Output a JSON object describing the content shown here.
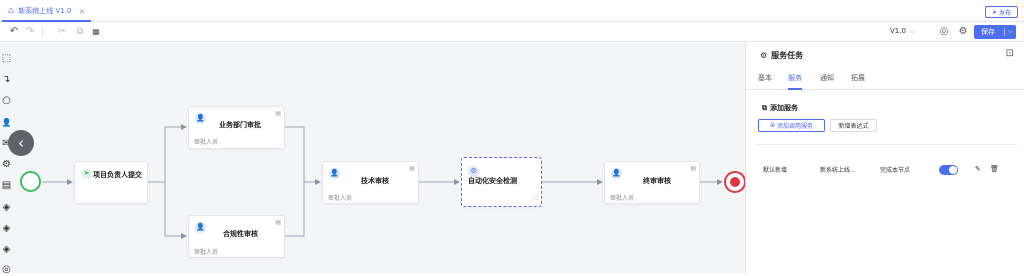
{
  "tab": {
    "icon": "flow-icon",
    "title": "新系统上线 V1.0",
    "close": "×"
  },
  "header": {
    "publish_label": "发布",
    "publish_icon": "send-icon"
  },
  "toolbar": {
    "undo": "↶",
    "redo": "↷",
    "cut": "✂",
    "copy": "⧉",
    "paste": "📋",
    "version": "V1.0",
    "version_chevron": "⌵",
    "save_label": "保存",
    "save_dropdown": "⌵"
  },
  "palette": [
    {
      "name": "select-tool-icon",
      "glyph": "⬚"
    },
    {
      "name": "connect-tool-icon",
      "glyph": "↴"
    },
    {
      "name": "start-event-icon",
      "glyph": "○"
    },
    {
      "name": "user-task-icon",
      "glyph": "👤"
    },
    {
      "name": "message-task-icon",
      "glyph": "✉"
    },
    {
      "name": "service-task-icon",
      "glyph": "⚙"
    },
    {
      "name": "script-task-icon",
      "glyph": "▤"
    },
    {
      "name": "exclusive-gateway-icon",
      "glyph": "◈"
    },
    {
      "name": "parallel-gateway-icon",
      "glyph": "◈"
    },
    {
      "name": "inclusive-gateway-icon",
      "glyph": "◈"
    },
    {
      "name": "end-event-icon",
      "glyph": "◎"
    }
  ],
  "collapse_glyph": "‹",
  "nodes": {
    "submit": {
      "title": "项目负责人提交"
    },
    "dept_review": {
      "title": "业务部门审批",
      "sub": "审批人员"
    },
    "compliance": {
      "title": "合规性审核",
      "sub": "审批人员"
    },
    "tech_review": {
      "title": "技术审核",
      "sub": "审批人员"
    },
    "auto_security": {
      "title": "自动化安全检测",
      "doc": "⛶"
    },
    "final_review": {
      "title": "终审审核",
      "sub": "审批人员"
    }
  },
  "panel": {
    "title": "服务任务",
    "close_icon": "⧉",
    "tabs": [
      "基本",
      "服务",
      "通知",
      "拓展"
    ],
    "active_tab": 1,
    "section_title": "添加服务",
    "btn_add_service": "添加调用服务",
    "btn_add_expression": "新增表达式",
    "row": {
      "col1": "默认新增",
      "col2": "新系统上线...",
      "col3": "完成本节点",
      "enabled": true
    }
  },
  "colors": {
    "accent": "#4e6ef2",
    "start": "#3bbf5c",
    "end": "#e0363f"
  }
}
